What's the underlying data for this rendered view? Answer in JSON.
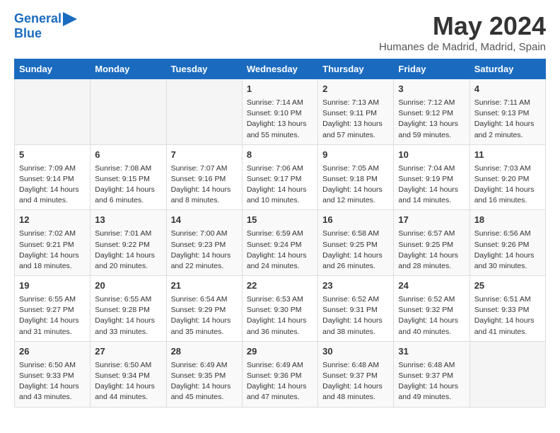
{
  "header": {
    "logo_line1": "General",
    "logo_line2": "Blue",
    "month_title": "May 2024",
    "location": "Humanes de Madrid, Madrid, Spain"
  },
  "days_of_week": [
    "Sunday",
    "Monday",
    "Tuesday",
    "Wednesday",
    "Thursday",
    "Friday",
    "Saturday"
  ],
  "weeks": [
    [
      {
        "day": "",
        "empty": true
      },
      {
        "day": "",
        "empty": true
      },
      {
        "day": "",
        "empty": true
      },
      {
        "day": "1",
        "sunrise": "7:14 AM",
        "sunset": "9:10 PM",
        "daylight": "13 hours and 55 minutes."
      },
      {
        "day": "2",
        "sunrise": "7:13 AM",
        "sunset": "9:11 PM",
        "daylight": "13 hours and 57 minutes."
      },
      {
        "day": "3",
        "sunrise": "7:12 AM",
        "sunset": "9:12 PM",
        "daylight": "13 hours and 59 minutes."
      },
      {
        "day": "4",
        "sunrise": "7:11 AM",
        "sunset": "9:13 PM",
        "daylight": "14 hours and 2 minutes."
      }
    ],
    [
      {
        "day": "5",
        "sunrise": "7:09 AM",
        "sunset": "9:14 PM",
        "daylight": "14 hours and 4 minutes."
      },
      {
        "day": "6",
        "sunrise": "7:08 AM",
        "sunset": "9:15 PM",
        "daylight": "14 hours and 6 minutes."
      },
      {
        "day": "7",
        "sunrise": "7:07 AM",
        "sunset": "9:16 PM",
        "daylight": "14 hours and 8 minutes."
      },
      {
        "day": "8",
        "sunrise": "7:06 AM",
        "sunset": "9:17 PM",
        "daylight": "14 hours and 10 minutes."
      },
      {
        "day": "9",
        "sunrise": "7:05 AM",
        "sunset": "9:18 PM",
        "daylight": "14 hours and 12 minutes."
      },
      {
        "day": "10",
        "sunrise": "7:04 AM",
        "sunset": "9:19 PM",
        "daylight": "14 hours and 14 minutes."
      },
      {
        "day": "11",
        "sunrise": "7:03 AM",
        "sunset": "9:20 PM",
        "daylight": "14 hours and 16 minutes."
      }
    ],
    [
      {
        "day": "12",
        "sunrise": "7:02 AM",
        "sunset": "9:21 PM",
        "daylight": "14 hours and 18 minutes."
      },
      {
        "day": "13",
        "sunrise": "7:01 AM",
        "sunset": "9:22 PM",
        "daylight": "14 hours and 20 minutes."
      },
      {
        "day": "14",
        "sunrise": "7:00 AM",
        "sunset": "9:23 PM",
        "daylight": "14 hours and 22 minutes."
      },
      {
        "day": "15",
        "sunrise": "6:59 AM",
        "sunset": "9:24 PM",
        "daylight": "14 hours and 24 minutes."
      },
      {
        "day": "16",
        "sunrise": "6:58 AM",
        "sunset": "9:25 PM",
        "daylight": "14 hours and 26 minutes."
      },
      {
        "day": "17",
        "sunrise": "6:57 AM",
        "sunset": "9:25 PM",
        "daylight": "14 hours and 28 minutes."
      },
      {
        "day": "18",
        "sunrise": "6:56 AM",
        "sunset": "9:26 PM",
        "daylight": "14 hours and 30 minutes."
      }
    ],
    [
      {
        "day": "19",
        "sunrise": "6:55 AM",
        "sunset": "9:27 PM",
        "daylight": "14 hours and 31 minutes."
      },
      {
        "day": "20",
        "sunrise": "6:55 AM",
        "sunset": "9:28 PM",
        "daylight": "14 hours and 33 minutes."
      },
      {
        "day": "21",
        "sunrise": "6:54 AM",
        "sunset": "9:29 PM",
        "daylight": "14 hours and 35 minutes."
      },
      {
        "day": "22",
        "sunrise": "6:53 AM",
        "sunset": "9:30 PM",
        "daylight": "14 hours and 36 minutes."
      },
      {
        "day": "23",
        "sunrise": "6:52 AM",
        "sunset": "9:31 PM",
        "daylight": "14 hours and 38 minutes."
      },
      {
        "day": "24",
        "sunrise": "6:52 AM",
        "sunset": "9:32 PM",
        "daylight": "14 hours and 40 minutes."
      },
      {
        "day": "25",
        "sunrise": "6:51 AM",
        "sunset": "9:33 PM",
        "daylight": "14 hours and 41 minutes."
      }
    ],
    [
      {
        "day": "26",
        "sunrise": "6:50 AM",
        "sunset": "9:33 PM",
        "daylight": "14 hours and 43 minutes."
      },
      {
        "day": "27",
        "sunrise": "6:50 AM",
        "sunset": "9:34 PM",
        "daylight": "14 hours and 44 minutes."
      },
      {
        "day": "28",
        "sunrise": "6:49 AM",
        "sunset": "9:35 PM",
        "daylight": "14 hours and 45 minutes."
      },
      {
        "day": "29",
        "sunrise": "6:49 AM",
        "sunset": "9:36 PM",
        "daylight": "14 hours and 47 minutes."
      },
      {
        "day": "30",
        "sunrise": "6:48 AM",
        "sunset": "9:37 PM",
        "daylight": "14 hours and 48 minutes."
      },
      {
        "day": "31",
        "sunrise": "6:48 AM",
        "sunset": "9:37 PM",
        "daylight": "14 hours and 49 minutes."
      },
      {
        "day": "",
        "empty": true
      }
    ]
  ],
  "cell_labels": {
    "sunrise": "Sunrise: ",
    "sunset": "Sunset: ",
    "daylight": "Daylight: "
  },
  "colors": {
    "header_bg": "#1a6bbf",
    "logo_blue": "#1a6bbf"
  }
}
